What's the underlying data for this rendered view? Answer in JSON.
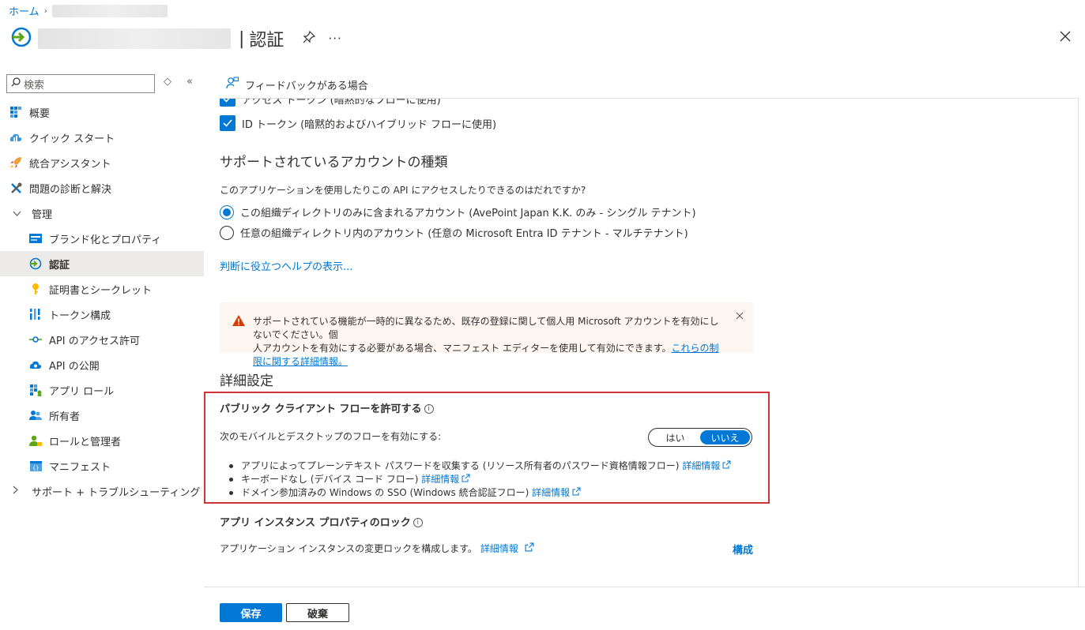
{
  "breadcrumb": {
    "home": "ホーム"
  },
  "header": {
    "separator": "|",
    "title": "認証",
    "more": "···"
  },
  "sidebar": {
    "search_placeholder": "検索",
    "items": [
      {
        "label": "概要",
        "icon": "overview-grid-icon"
      },
      {
        "label": "クイック スタート",
        "icon": "cloud-icon"
      },
      {
        "label": "統合アシスタント",
        "icon": "rocket-icon"
      },
      {
        "label": "問題の診断と解決",
        "icon": "wrench-icon"
      },
      {
        "label": "管理",
        "icon": "chevron-down-icon"
      },
      {
        "label": "ブランド化とプロパティ",
        "icon": "branding-icon"
      },
      {
        "label": "認証",
        "icon": "authentication-icon"
      },
      {
        "label": "証明書とシークレット",
        "icon": "key-icon"
      },
      {
        "label": "トークン構成",
        "icon": "token-bars-icon"
      },
      {
        "label": "API のアクセス許可",
        "icon": "api-permissions-icon"
      },
      {
        "label": "API の公開",
        "icon": "cloud-api-icon"
      },
      {
        "label": "アプリ ロール",
        "icon": "app-roles-icon"
      },
      {
        "label": "所有者",
        "icon": "owners-icon"
      },
      {
        "label": "ロールと管理者",
        "icon": "roles-admins-icon"
      },
      {
        "label": "マニフェスト",
        "icon": "manifest-icon"
      },
      {
        "label": "サポート + トラブルシューティング",
        "icon": "chevron-right-icon"
      }
    ]
  },
  "toolbar": {
    "feedback": "フィードバックがある場合"
  },
  "implicit": {
    "access_token": "アクセス トークン (暗黙的なフローに使用)",
    "id_token": "ID トークン (暗黙的およびハイブリッド フローに使用)"
  },
  "accounts": {
    "heading": "サポートされているアカウントの種類",
    "question": "このアプリケーションを使用したりこの API にアクセスしたりできるのはだれですか?",
    "option_single": "この組織ディレクトリのみに含まれるアカウント (AvePoint Japan K.K. のみ - シングル テナント)",
    "option_multi": "任意の組織ディレクトリ内のアカウント (任意の Microsoft Entra ID テナント - マルチテナント)",
    "help_link": "判断に役立つヘルプの表示..."
  },
  "warning": {
    "text_line1": "サポートされている機能が一時的に異なるため、既存の登録に関して個人用 Microsoft アカウントを有効にしないでください。個",
    "text_line2": "人アカウントを有効にする必要がある場合、マニフェスト エディターを使用して有効にできます。",
    "link": "これらの制限に関する詳細情報。",
    "color": "#d83b01"
  },
  "advanced": {
    "heading": "詳細設定",
    "public_client_title": "パブリック クライアント フローを許可する",
    "enable_flows_label": "次のモバイルとデスクトップのフローを有効にする:",
    "toggle_yes": "はい",
    "toggle_no": "いいえ",
    "toggle_selected": "いいえ",
    "bullets": [
      {
        "text": "アプリによってプレーンテキスト パスワードを収集する (リソース所有者のパスワード資格情報フロー)",
        "link": "詳細情報"
      },
      {
        "text": "キーボードなし (デバイス コード フロー)",
        "link": "詳細情報"
      },
      {
        "text": "ドメイン参加済みの Windows の SSO (Windows 統合認証フロー)",
        "link": "詳細情報"
      }
    ],
    "instance_lock_title": "アプリ インスタンス プロパティのロック",
    "instance_lock_text": "アプリケーション インスタンスの変更ロックを構成します。",
    "instance_lock_link": "詳細情報",
    "configure": "構成"
  },
  "footer": {
    "save": "保存",
    "discard": "破棄"
  },
  "colors": {
    "accent": "#0078d4",
    "highlight_border": "#d13438",
    "warning_bg": "#fdf6f1"
  }
}
